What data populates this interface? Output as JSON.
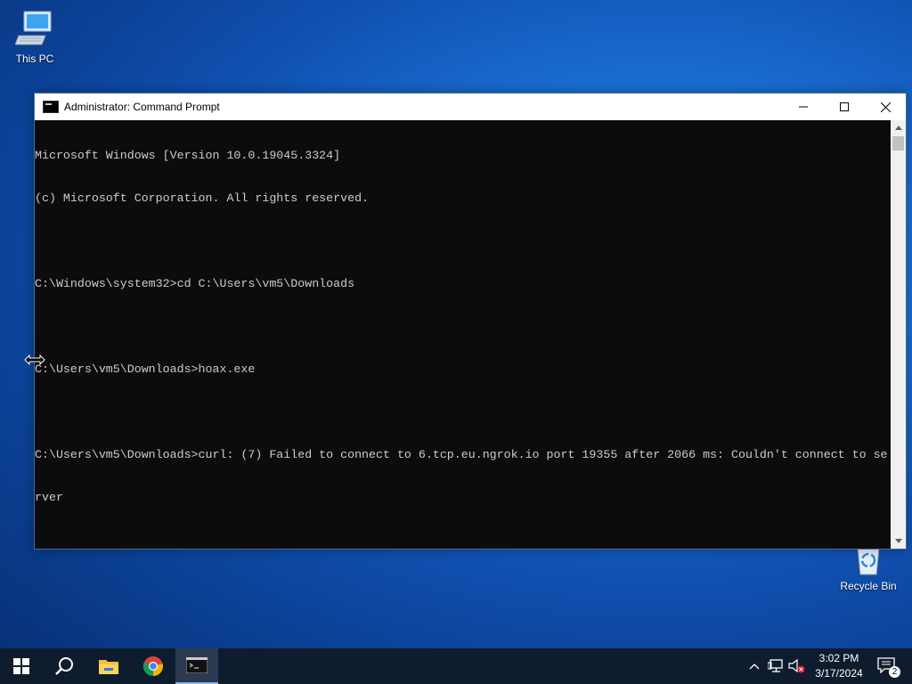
{
  "desktop": {
    "icons": [
      {
        "label": "This PC",
        "icon": "computer-icon"
      },
      {
        "label": "Recycle Bin",
        "icon": "recycle-bin-icon"
      }
    ]
  },
  "window": {
    "title": "Administrator: Command Prompt",
    "icon": "cmd-icon",
    "controls": [
      "minimize",
      "maximize",
      "close"
    ],
    "console_lines": [
      "Microsoft Windows [Version 10.0.19045.3324]",
      "(c) Microsoft Corporation. All rights reserved.",
      "",
      "C:\\Windows\\system32>cd C:\\Users\\vm5\\Downloads",
      "",
      "C:\\Users\\vm5\\Downloads>hoax.exe",
      "",
      "C:\\Users\\vm5\\Downloads>curl: (7) Failed to connect to 6.tcp.eu.ngrok.io port 19355 after 2066 ms: Couldn't connect to se",
      "rver"
    ]
  },
  "taskbar": {
    "buttons": [
      "start-icon",
      "search-icon",
      "file-explorer-icon",
      "chrome-icon",
      "cmd-icon"
    ],
    "tray": {
      "icons": [
        "chevron-up-icon",
        "network-icon",
        "volume-muted-icon"
      ],
      "time": "3:02 PM",
      "date": "3/17/2024",
      "notifications": "2"
    }
  },
  "colors": {
    "console_bg": "#0c0c0c",
    "console_text": "#cccccc",
    "taskbar_bg": "#0f1c2e",
    "accent": "#0a64d2"
  }
}
